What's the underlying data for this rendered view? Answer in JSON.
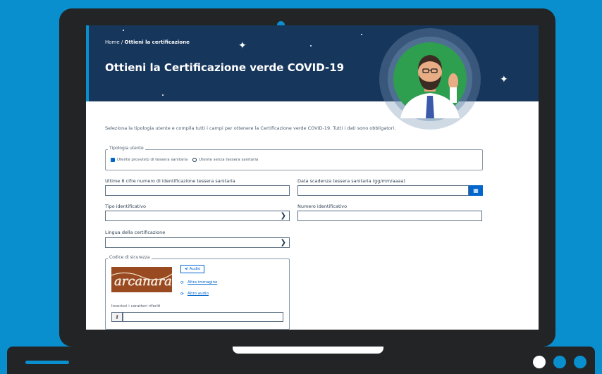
{
  "page": {
    "breadcrumb_home": "Home",
    "breadcrumb_separator": "/",
    "breadcrumb_current": "Ottieni la certificazione",
    "title": "Ottieni la Certificazione verde COVID-19",
    "intro": "Seleziona la tipologia utente e compila tutti i campi per ottenere la Certificazione verde COVID-19. Tutti i dati sono obbligatori."
  },
  "form": {
    "user_type_legend": "Tipologia utente",
    "user_type_options": [
      {
        "label": "Utente provvisto di tessera sanitaria",
        "checked": true
      },
      {
        "label": "Utente senza tessera sanitaria",
        "checked": false
      }
    ],
    "card_number_label": "Ultime 8 cifre numero di identificazione tessera sanitaria",
    "card_number_value": "",
    "expiry_label": "Data scadenza tessera sanitaria (gg/mm/aaaa)",
    "expiry_value": "",
    "id_type_label": "Tipo identificativo",
    "id_type_value": "",
    "id_number_label": "Numero identificativo",
    "id_number_value": "",
    "language_label": "Lingua della certificazione",
    "language_value": "",
    "security_legend": "Codice di sicurezza",
    "audio_label": "Audio",
    "other_image_label": "Altra immagine",
    "other_audio_label": "Altro audio",
    "captcha_text": "arcanara",
    "captcha_input_label": "Inserisci i caratteri riferiti",
    "captcha_input_value": ""
  },
  "icons": {
    "calendar": "calendar-icon",
    "chevron": "chevron-down-icon",
    "speaker": "speaker-icon",
    "refresh": "refresh-icon",
    "key": "key-icon"
  },
  "colors": {
    "background": "#0a8fce",
    "hero": "#17365c",
    "primary": "#0066cc",
    "laptop": "#232426"
  }
}
